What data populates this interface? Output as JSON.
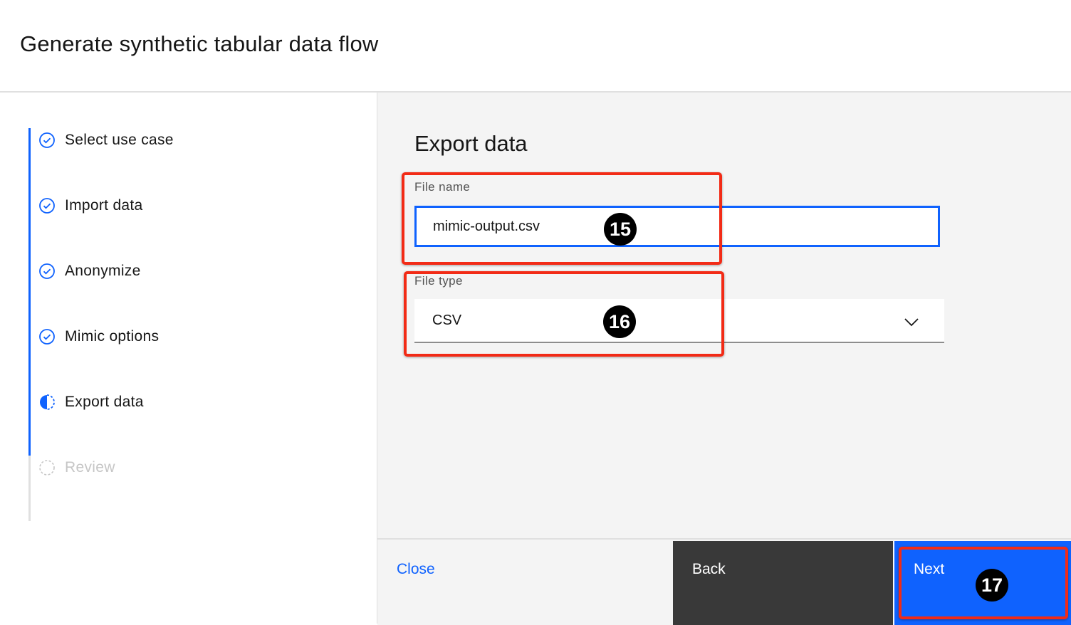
{
  "header": {
    "title": "Generate synthetic tabular data flow"
  },
  "steps": [
    {
      "label": "Select use case",
      "status": "complete"
    },
    {
      "label": "Import data",
      "status": "complete"
    },
    {
      "label": "Anonymize",
      "status": "complete"
    },
    {
      "label": "Mimic options",
      "status": "complete"
    },
    {
      "label": "Export data",
      "status": "current"
    },
    {
      "label": "Review",
      "status": "incomplete"
    }
  ],
  "main": {
    "title": "Export data",
    "file_name": {
      "label": "File name",
      "value": "mimic-output.csv"
    },
    "file_type": {
      "label": "File type",
      "selected": "CSV"
    }
  },
  "footer": {
    "close_label": "Close",
    "back_label": "Back",
    "next_label": "Next"
  },
  "annotations": {
    "badge_15": "15",
    "badge_16": "16",
    "badge_17": "17"
  },
  "colors": {
    "accent": "#0f62fe",
    "annotation": "#f22b16",
    "back_button": "#393939"
  }
}
